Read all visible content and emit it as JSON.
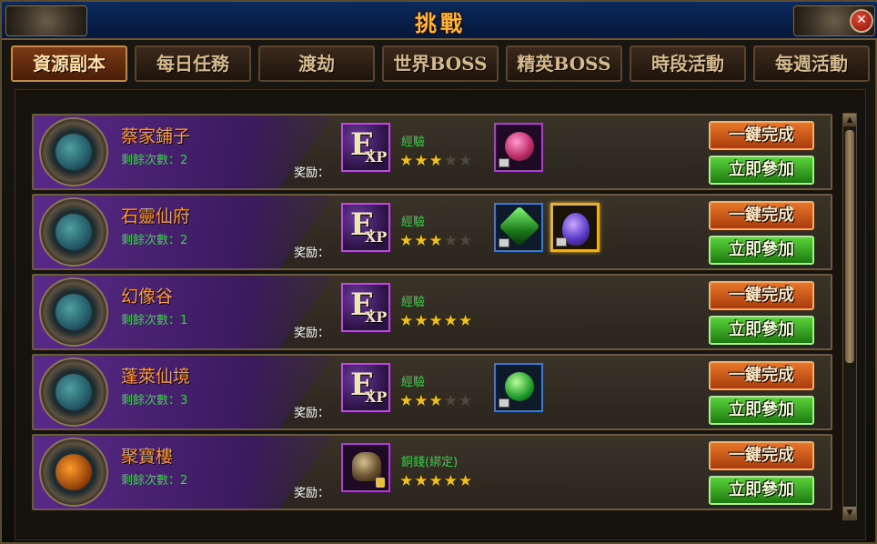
{
  "window": {
    "title": "挑戰",
    "close_label": "✕"
  },
  "tabs": [
    {
      "label": "資源副本",
      "active": true
    },
    {
      "label": "每日任務",
      "active": false
    },
    {
      "label": "渡劫",
      "active": false
    },
    {
      "label": "世界BOSS",
      "active": false
    },
    {
      "label": "精英BOSS",
      "active": false
    },
    {
      "label": "時段活動",
      "active": false
    },
    {
      "label": "每週活動",
      "active": false
    }
  ],
  "reward_label": "奖励：",
  "buttons": {
    "complete": "一鍵完成",
    "join": "立即參加"
  },
  "rows": [
    {
      "name": "蔡家鋪子",
      "remaining": "剩餘次數：2",
      "reward_name": "經驗",
      "stars": 3
    },
    {
      "name": "石靈仙府",
      "remaining": "剩餘次數：2",
      "reward_name": "經驗",
      "stars": 3
    },
    {
      "name": "幻像谷",
      "remaining": "剩餘次數：1",
      "reward_name": "經驗",
      "stars": 5
    },
    {
      "name": "蓬萊仙境",
      "remaining": "剩餘次數：3",
      "reward_name": "經驗",
      "stars": 3
    },
    {
      "name": "聚寶樓",
      "remaining": "剩餘次數：2",
      "reward_name": "銅錢(綁定)",
      "stars": 5
    }
  ],
  "icons": {
    "exp": {
      "e": "E",
      "xp": "XP"
    },
    "scroll_up": "▲",
    "scroll_down": "▼"
  },
  "colors": {
    "title": "#ffb43a",
    "row_name": "#ff9c3a",
    "remaining": "#3bd04a",
    "complete_btn": "#e8762a",
    "join_btn": "#5ad23a"
  }
}
